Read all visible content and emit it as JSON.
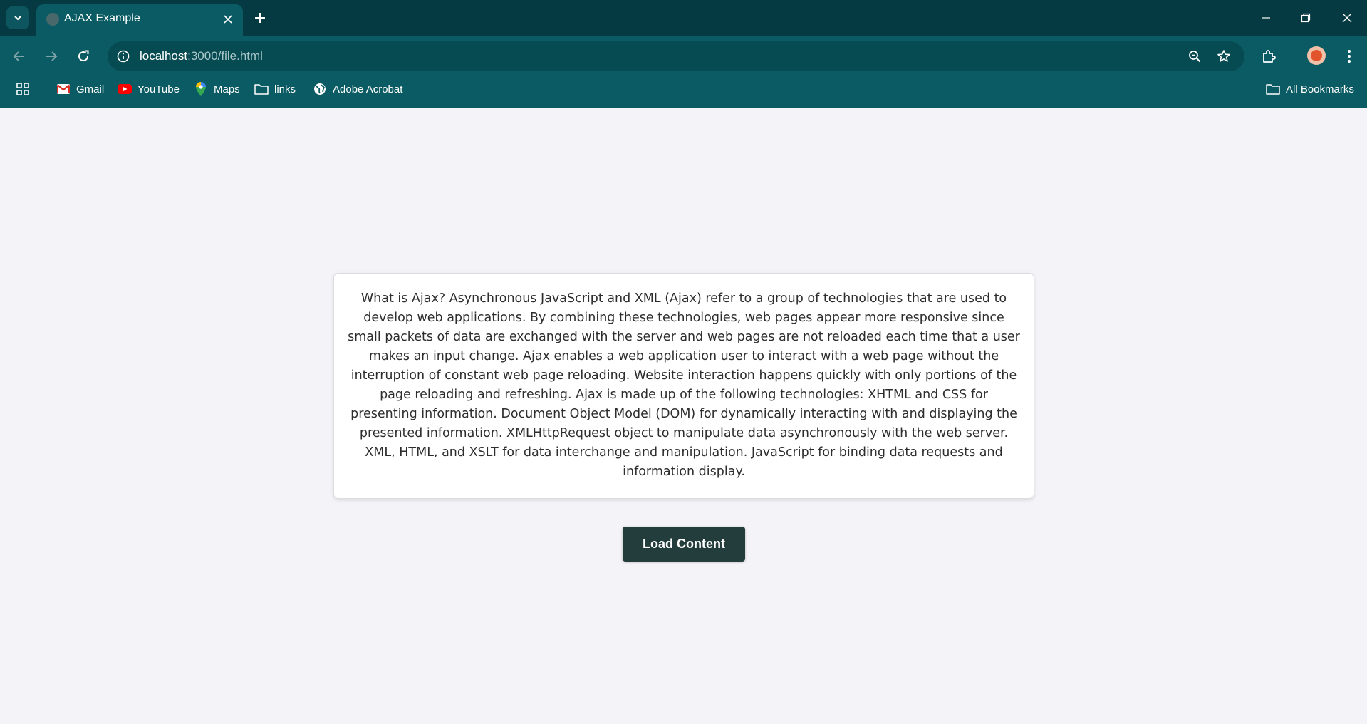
{
  "browser": {
    "tab_title": "AJAX Example",
    "url_host": "localhost",
    "url_path": ":3000/file.html",
    "bookmarks": [
      {
        "label": "Gmail",
        "icon": "gmail-icon"
      },
      {
        "label": "YouTube",
        "icon": "youtube-icon"
      },
      {
        "label": "Maps",
        "icon": "maps-icon"
      },
      {
        "label": "links",
        "icon": "folder-icon"
      },
      {
        "label": "Adobe Acrobat",
        "icon": "globe-icon"
      }
    ],
    "all_bookmarks_label": "All Bookmarks"
  },
  "page": {
    "content_text": "What is Ajax? Asynchronous JavaScript and XML (Ajax) refer to a group of technologies that are used to develop web applications. By combining these technologies, web pages appear more responsive since small packets of data are exchanged with the server and web pages are not reloaded each time that a user makes an input change. Ajax enables a web application user to interact with a web page without the interruption of constant web page reloading. Website interaction happens quickly with only portions of the page reloading and refreshing. Ajax is made up of the following technologies: XHTML and CSS for presenting information. Document Object Model (DOM) for dynamically interacting with and displaying the presented information. XMLHttpRequest object to manipulate data asynchronously with the web server. XML, HTML, and XSLT for data interchange and manipulation. JavaScript for binding data requests and information display.",
    "button_label": "Load Content"
  },
  "colors": {
    "titlebar": "#063a42",
    "toolbar": "#0a5b63",
    "page_background": "#f4f4f8",
    "button_background": "#233c3c"
  }
}
